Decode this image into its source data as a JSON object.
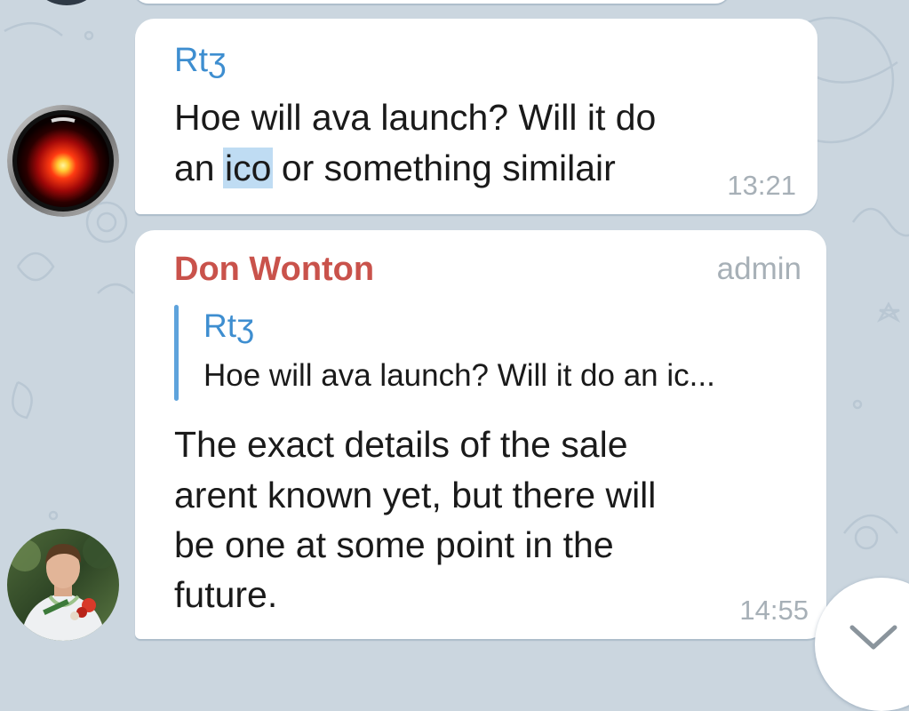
{
  "messages": [
    {
      "sender": "Rtʒ",
      "line1": "Hoe will ava launch? Will it do",
      "line2_before": "an ",
      "line2_selected": "ico",
      "line2_after": " or something similair",
      "time": "13:21",
      "avatar": "hal-9000-eye-avatar"
    },
    {
      "sender": "Don Wonton",
      "role": "admin",
      "reply": {
        "sender": "Rtʒ",
        "text": "Hoe will ava launch? Will it do an ic..."
      },
      "lines": [
        "The exact details of the sale",
        "arent known yet, but there will",
        "be one at  some point in the",
        "future."
      ],
      "time": "14:55",
      "avatar": "user-photo-avatar"
    }
  ],
  "scroll_button": {
    "icon": "chevron-down-icon"
  },
  "colors": {
    "background": "#cbd6df",
    "bubble": "#ffffff",
    "sender_blue": "#3e8ed0",
    "sender_red": "#c9524b",
    "selection": "#bfdcf3",
    "timestamp": "#a7b0b7"
  }
}
